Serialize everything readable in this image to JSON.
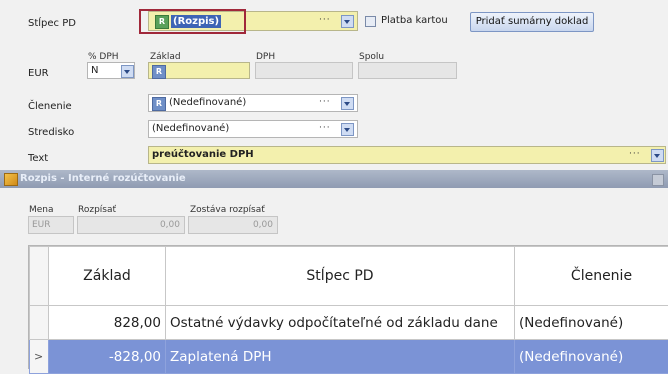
{
  "form": {
    "stlpec_label": "Stĺpec PD",
    "stlpec_value": "(Rozpis)",
    "platba_label": "Platba kartou",
    "pridat_button": "Pridať sumárny doklad",
    "currency_label": "EUR",
    "dph_pct_label": "% DPH",
    "dph_pct_value": "N",
    "zaklad_label": "Základ",
    "dph_label": "DPH",
    "spolu_label": "Spolu",
    "clenenie_label": "Členenie",
    "clenenie_value": "(Nedefinované)",
    "stredisko_label": "Stredisko",
    "stredisko_value": "(Nedefinované)",
    "text_label": "Text",
    "text_value": "preúčtovanie DPH",
    "r_badge": "R",
    "dots": "···"
  },
  "rozpis": {
    "title": "Rozpis - Interné rozúčtovanie",
    "mena_label": "Mena",
    "mena_value": "EUR",
    "rozpisat_label": "Rozpísať",
    "rozpisat_value": "0,00",
    "zostava_label": "Zostáva rozpísať",
    "zostava_value": "0,00"
  },
  "table": {
    "columns": [
      "Základ",
      "Stĺpec PD",
      "Členenie"
    ],
    "rows": [
      {
        "zaklad": "828,00",
        "stlpec": "Ostatné výdavky odpočítateľné od základu dane",
        "clenenie": "(Nedefinované)"
      },
      {
        "marker": ">",
        "zaklad": "-828,00",
        "stlpec": "Zaplatená DPH",
        "clenenie": "(Nedefinované)"
      }
    ]
  },
  "colors": {
    "highlight_border": "#a0283a",
    "selected_row": "#7b93d6",
    "yellow_field": "#f3f0ad"
  }
}
